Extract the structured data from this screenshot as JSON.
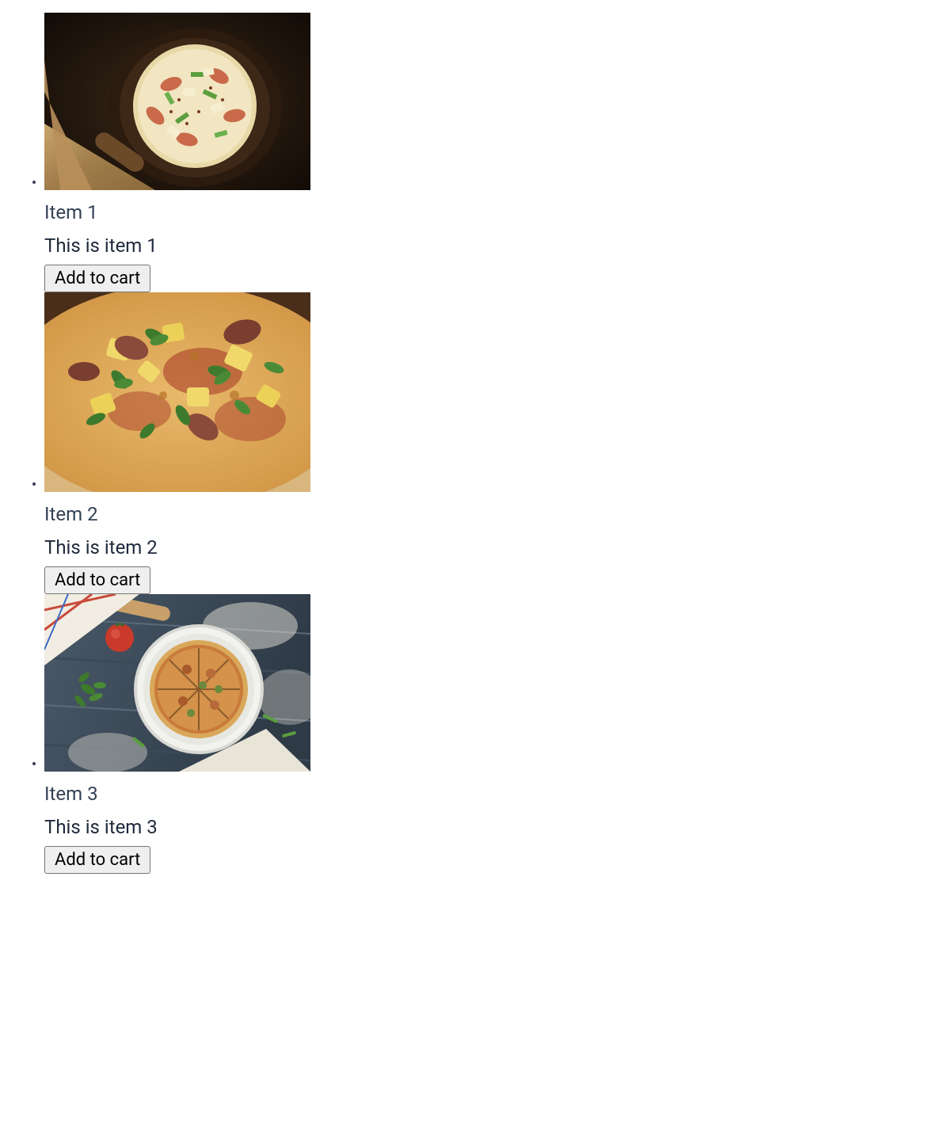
{
  "items": [
    {
      "title": "Item 1",
      "description": "This is item 1",
      "button_label": "Add to cart",
      "image_alt": "pizza-on-wooden-pan"
    },
    {
      "title": "Item 2",
      "description": "This is item 2",
      "button_label": "Add to cart",
      "image_alt": "hawaiian-pizza-closeup"
    },
    {
      "title": "Item 3",
      "description": "This is item 3",
      "button_label": "Add to cart",
      "image_alt": "sliced-pizza-on-plate"
    }
  ]
}
